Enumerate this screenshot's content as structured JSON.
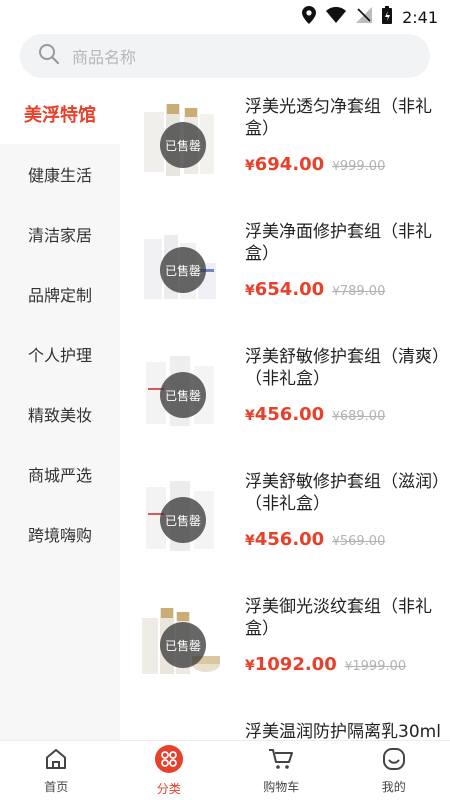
{
  "status": {
    "time": "2:41",
    "icons": [
      "location-icon",
      "wifi-icon",
      "signal-icon",
      "battery-icon"
    ]
  },
  "search": {
    "placeholder": "商品名称",
    "icon": "search-icon"
  },
  "sidebar": {
    "items": [
      {
        "label": "美浮特馆",
        "active": true
      },
      {
        "label": "健康生活"
      },
      {
        "label": "清洁家居"
      },
      {
        "label": "品牌定制"
      },
      {
        "label": "个人护理"
      },
      {
        "label": "精致美妆"
      },
      {
        "label": "商城严选"
      },
      {
        "label": "跨境嗨购"
      }
    ]
  },
  "products": [
    {
      "name": "浮美光透匀净套组（非礼盒）",
      "currency": "¥",
      "price": "694.00",
      "original_price": "999.00",
      "sold_label": "已售罄"
    },
    {
      "name": "浮美净面修护套组（非礼盒）",
      "currency": "¥",
      "price": "654.00",
      "original_price": "789.00",
      "sold_label": "已售罄"
    },
    {
      "name": "浮美舒敏修护套组（清爽）（非礼盒）",
      "currency": "¥",
      "price": "456.00",
      "original_price": "689.00",
      "sold_label": "已售罄"
    },
    {
      "name": "浮美舒敏修护套组（滋润）（非礼盒）",
      "currency": "¥",
      "price": "456.00",
      "original_price": "569.00",
      "sold_label": "已售罄"
    },
    {
      "name": "浮美御光淡纹套组（非礼盒）",
      "currency": "¥",
      "price": "1092.00",
      "original_price": "1999.00",
      "sold_label": "已售罄"
    },
    {
      "name": "浮美温润防护隔离乳30ml",
      "currency": "¥",
      "price": "",
      "original_price": "",
      "sold_label": ""
    }
  ],
  "tabbar": {
    "items": [
      {
        "label": "首页",
        "icon": "home-icon"
      },
      {
        "label": "分类",
        "icon": "category-icon",
        "active": true
      },
      {
        "label": "购物车",
        "icon": "cart-icon"
      },
      {
        "label": "我的",
        "icon": "profile-icon"
      }
    ]
  },
  "colors": {
    "accent": "#e8402a",
    "sidebar_bg": "#f7f7f7",
    "search_bg": "#f2f3f5"
  }
}
